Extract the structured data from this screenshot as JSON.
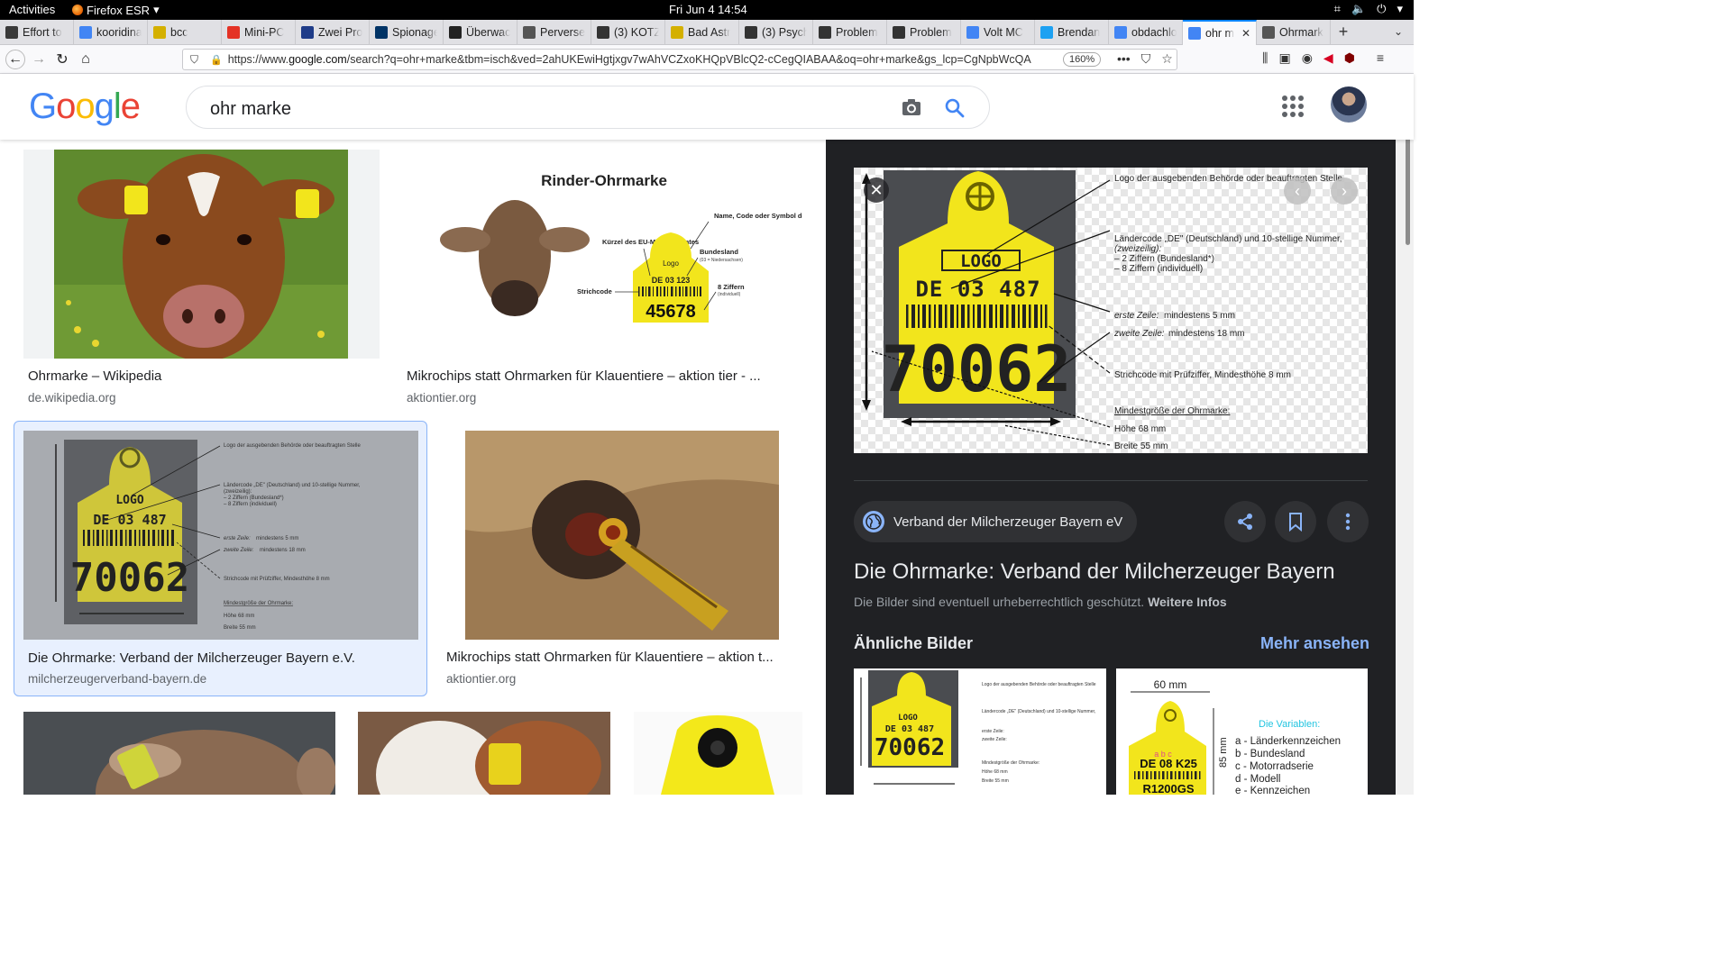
{
  "system": {
    "activities": "Activities",
    "app_name": "Firefox ESR",
    "clock": "Fri Jun 4  14:54"
  },
  "tabs": [
    {
      "label": "Effort to",
      "icon": "wp-icon",
      "color": "#3a3a3a"
    },
    {
      "label": "kooridina",
      "icon": "google-icon",
      "color": "#4285f4"
    },
    {
      "label": "bcc",
      "icon": "bcc-icon",
      "color": "#d4b000"
    },
    {
      "label": "Mini-PC",
      "icon": "ali-icon",
      "color": "#e43225"
    },
    {
      "label": "Zwei Pro",
      "icon": "flag-icon",
      "color": "#1f3c88"
    },
    {
      "label": "Spionage",
      "icon": "az-icon",
      "color": "#003366"
    },
    {
      "label": "Überwac",
      "icon": "zeit-icon",
      "color": "#222222"
    },
    {
      "label": "Perverse",
      "icon": "wiki-icon",
      "color": "#555555"
    },
    {
      "label": "(3) KOTZ",
      "icon": "warn-icon",
      "color": "#333333"
    },
    {
      "label": "Bad Astr",
      "icon": "bad-icon",
      "color": "#d4b000"
    },
    {
      "label": "(3) Psych",
      "icon": "warn-icon",
      "color": "#333333"
    },
    {
      "label": "Problem",
      "icon": "warn-icon",
      "color": "#333333"
    },
    {
      "label": "Problem",
      "icon": "warn-icon",
      "color": "#333333"
    },
    {
      "label": "Volt MC",
      "icon": "google-icon",
      "color": "#4285f4"
    },
    {
      "label": "Brendan",
      "icon": "twitter-icon",
      "color": "#1da1f2"
    },
    {
      "label": "obdachlo",
      "icon": "google-icon",
      "color": "#4285f4"
    },
    {
      "label": "ohr m",
      "icon": "google-icon",
      "color": "#4285f4",
      "active": true
    },
    {
      "label": "Ohrmark",
      "icon": "wiki-icon",
      "color": "#555555"
    }
  ],
  "browser": {
    "url_prefix": "https://www.",
    "url_domain": "google.com",
    "url_rest": "/search?q=ohr+marke&tbm=isch&ved=2ahUKEwiHgtjxgv7wAhVCZxoKHQpVBlcQ2-cCegQIABAA&oq=ohr+marke&gs_lcp=CgNpbWcQA",
    "zoom": "160%"
  },
  "search": {
    "query": "ohr marke"
  },
  "results": [
    {
      "title": "Ohrmarke – Wikipedia",
      "source": "de.wikipedia.org"
    },
    {
      "title": "Mikrochips statt Ohrmarken für Klauentiere – aktion tier - ...",
      "source": "aktiontier.org"
    },
    {
      "title": "Die Ohrmarke: Verband der Milcherzeuger Bayern e.V.",
      "source": "milcherzeugerverband-bayern.de"
    },
    {
      "title": "Mikrochips statt Ohrmarken für Klauentiere – aktion t...",
      "source": "aktiontier.org"
    }
  ],
  "rinder_diagram": {
    "title": "Rinder-Ohrmarke",
    "label_name": "Name, Code oder Symbol der zuständigen Behörde",
    "label_eu": "Kürzel des EU-Mitgliedstaates",
    "label_bundesland": "Bundesland",
    "label_bundesland_sub": "(03 = Niedersachsen)",
    "label_strichcode": "Strichcode",
    "label_ziffern": "8 Ziffern",
    "label_ziffern_sub": "(individuell)",
    "tag_logo": "Logo",
    "tag_line1": "DE  03  123",
    "tag_number": "45678"
  },
  "preview_diagram": {
    "tag_logo": "LOGO",
    "tag_line1": "DE 03 487",
    "tag_number": "70062",
    "ann1": "Logo der ausgebenden Behörde oder beauftragten Stelle",
    "ann2": "Ländercode „DE\" (Deutschland) und 10-stellige Nummer,",
    "ann2b": "(zweizeilig):",
    "ann2c": "– 2 Ziffern (Bundesland*)",
    "ann2d": "– 8 Ziffern (individuell)",
    "ann3a": "erste Zeile:",
    "ann3b": " mindestens 5 mm",
    "ann4a": "zweite Zeile:",
    "ann4b": " mindestens 18 mm",
    "ann5": "Strichcode mit Prüfziffer, Mindesthöhe 8 mm",
    "ann6": "Mindestgröße der Ohrmarke:",
    "ann7": "Höhe 68 mm",
    "ann8": "Breite 55 mm"
  },
  "pane": {
    "source_name": "Verband der Milcherzeuger Bayern eV",
    "title": "Die Ohrmarke: Verband der Milcherzeuger Bayern",
    "copyright": "Die Bilder sind eventuell urheberrechtlich geschützt.",
    "more_info": "Weitere Infos",
    "similar": "Ähnliche Bilder",
    "see_more": "Mehr ansehen"
  },
  "similar2": {
    "width_label": "60 mm",
    "height_label": "85 mm",
    "var_title": "Die Variablen:",
    "vars": [
      "a - Länderkennzeichen",
      "b - Bundesland",
      "c - Motorradserie",
      "d - Modell",
      "e - Kennzeichen"
    ],
    "tag_line1": "DE 08 K25",
    "tag_line2": "R1200GS",
    "tag_letters": "a  b  c"
  },
  "colors": {
    "tag_yellow": "#f2e51c",
    "pane_bg": "#202124",
    "link_blue": "#8ab4f8"
  }
}
